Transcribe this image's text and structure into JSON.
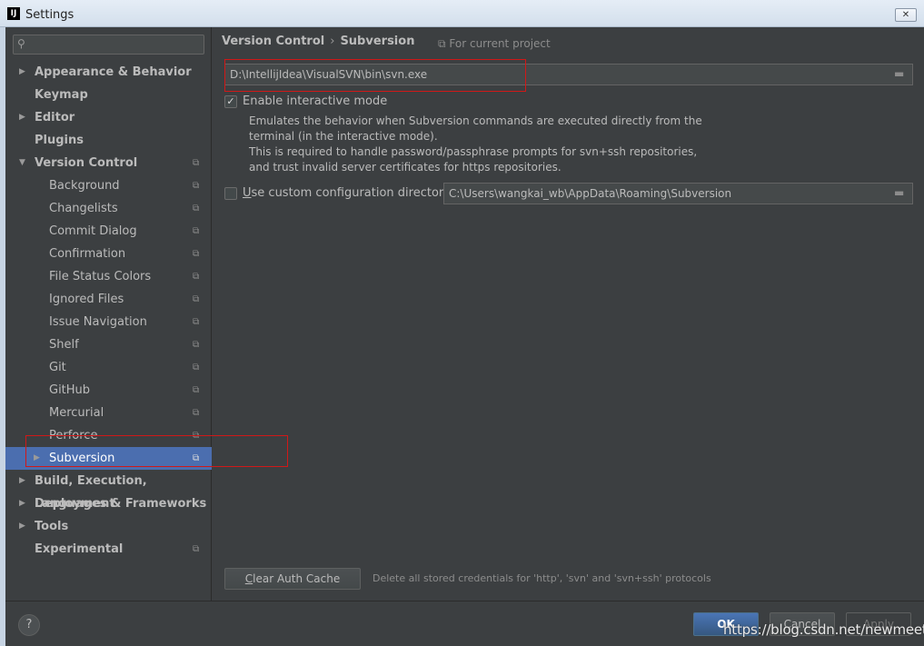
{
  "window": {
    "title": "Settings",
    "app_icon_text": "IJ",
    "close_glyph": "✕"
  },
  "sidebar": {
    "search_placeholder": "",
    "items": [
      {
        "label": "Appearance & Behavior",
        "bold": true,
        "arrow": "▶"
      },
      {
        "label": "Keymap",
        "bold": true
      },
      {
        "label": "Editor",
        "bold": true,
        "arrow": "▶"
      },
      {
        "label": "Plugins",
        "bold": true
      },
      {
        "label": "Version Control",
        "bold": true,
        "arrow": "▼"
      },
      {
        "label": "Background"
      },
      {
        "label": "Changelists"
      },
      {
        "label": "Commit Dialog"
      },
      {
        "label": "Confirmation"
      },
      {
        "label": "File Status Colors"
      },
      {
        "label": "Ignored Files"
      },
      {
        "label": "Issue Navigation"
      },
      {
        "label": "Shelf"
      },
      {
        "label": "Git"
      },
      {
        "label": "GitHub"
      },
      {
        "label": "Mercurial"
      },
      {
        "label": "Perforce"
      },
      {
        "label": "Subversion",
        "arrow": "▶",
        "selected": true
      },
      {
        "label": "Build, Execution, Deployment",
        "bold": true,
        "arrow": "▶"
      },
      {
        "label": "Languages & Frameworks",
        "bold": true,
        "arrow": "▶"
      },
      {
        "label": "Tools",
        "bold": true,
        "arrow": "▶"
      },
      {
        "label": "Experimental",
        "bold": true
      }
    ]
  },
  "content": {
    "breadcrumb_parent": "Version Control",
    "breadcrumb_separator": "›",
    "breadcrumb_current": "Subversion",
    "project_note": "For current project",
    "svn_path": "D:\\IntellijIdea\\VisualSVN\\bin\\svn.exe",
    "interactive_mode_label": "Enable interactive mode",
    "interactive_mode_checked": true,
    "interactive_desc_1": "Emulates the behavior when Subversion commands are executed directly from the",
    "interactive_desc_2": "terminal (in the interactive mode).",
    "interactive_desc_3": "This is required to handle password/passphrase prompts for svn+ssh repositories,",
    "interactive_desc_4": "and trust invalid server certificates for https repositories.",
    "custom_config_label_u": "U",
    "custom_config_label_rest": "se custom configuration directory:",
    "custom_config_checked": false,
    "config_path": "C:\\Users\\wangkai_wb\\AppData\\Roaming\\Subversion",
    "clear_cache_u": "C",
    "clear_cache_rest": "lear Auth Cache",
    "clear_cache_note": "Delete all stored credentials for 'http', 'svn' and 'svn+ssh' protocols"
  },
  "footer": {
    "help": "?",
    "ok": "OK",
    "cancel": "Cancel",
    "apply": "Apply",
    "watermark": "https://blog.csdn.net/newmeet"
  },
  "colors": {
    "background": "#3c3f41",
    "selection": "#4b6eaf",
    "annotation": "#d01818"
  }
}
